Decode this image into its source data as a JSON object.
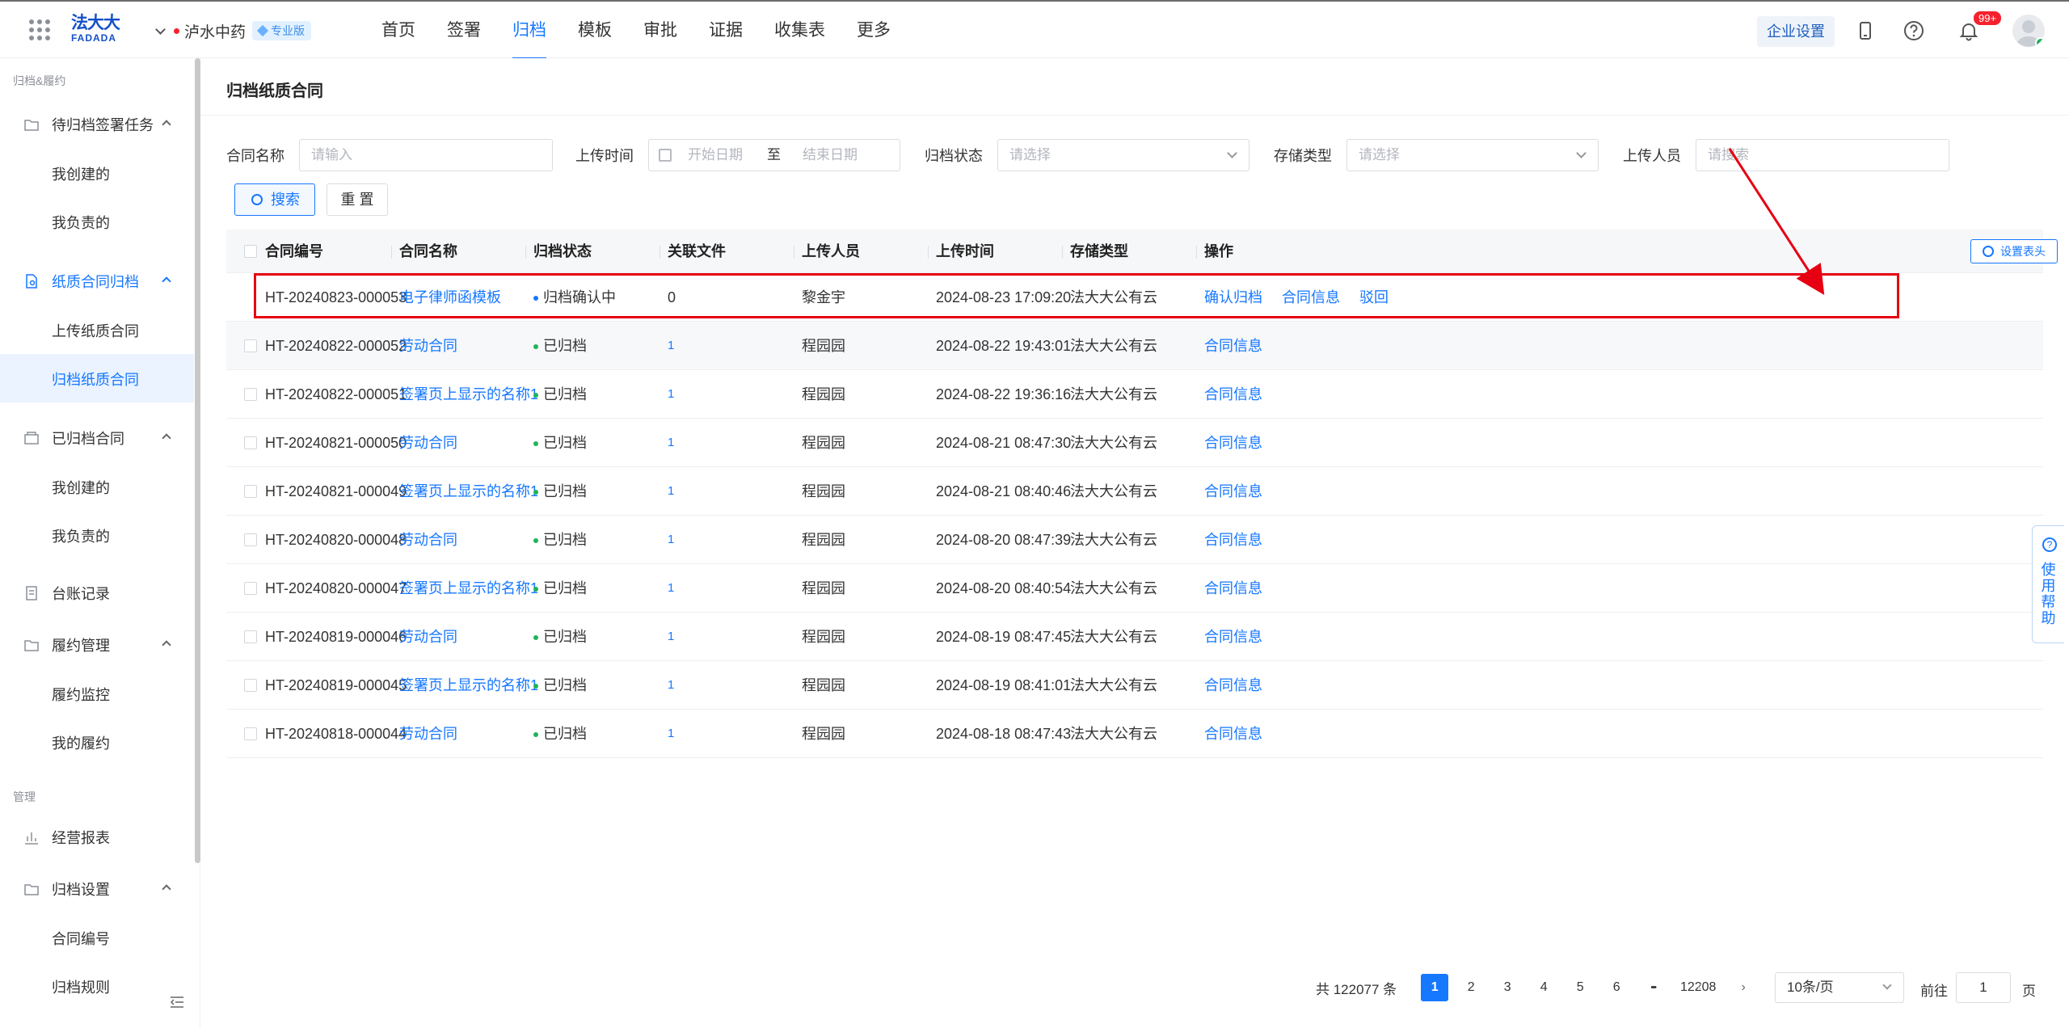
{
  "app": {
    "logo_cn": "法大大",
    "logo_en": "FADADA",
    "org_name": "泸水中药",
    "edition": "专业版",
    "nav": [
      "首页",
      "签署",
      "归档",
      "模板",
      "审批",
      "证据",
      "收集表",
      "更多"
    ],
    "nav_active": 2,
    "corp_settings": "企业设置",
    "notif_count": "99+"
  },
  "sidebar": {
    "group1": "归档&履约",
    "group2": "管理",
    "items": [
      {
        "label": "待归档签署任务",
        "icon": "folder-icon",
        "sub": [
          "我创建的",
          "我负责的"
        ]
      },
      {
        "label": "纸质合同归档",
        "icon": "file-search-icon",
        "sub": [
          "上传纸质合同",
          "归档纸质合同"
        ],
        "active_sub": 1
      },
      {
        "label": "已归档合同",
        "icon": "archive-box-icon",
        "sub": [
          "我创建的",
          "我负责的"
        ]
      },
      {
        "label": "台账记录",
        "icon": "ledger-icon",
        "sub": []
      },
      {
        "label": "履约管理",
        "icon": "folder-check-icon",
        "sub": [
          "履约监控",
          "我的履约"
        ]
      },
      {
        "label": "经营报表",
        "icon": "bar-chart-icon",
        "sub": []
      },
      {
        "label": "归档设置",
        "icon": "folder-settings-icon",
        "sub": [
          "合同编号",
          "归档规则"
        ]
      }
    ]
  },
  "page": {
    "title": "归档纸质合同",
    "filters": {
      "contract_name_label": "合同名称",
      "contract_name_placeholder": "请输入",
      "upload_time_label": "上传时间",
      "start_date": "开始日期",
      "to": "至",
      "end_date": "结束日期",
      "status_label": "归档状态",
      "status_placeholder": "请选择",
      "storage_label": "存储类型",
      "storage_placeholder": "请选择",
      "uploader_label": "上传人员",
      "uploader_placeholder": "请搜索"
    },
    "search_btn": "搜索",
    "reset_btn": "重 置",
    "set_columns": "设置表头"
  },
  "table": {
    "columns": [
      "合同编号",
      "合同名称",
      "归档状态",
      "关联文件",
      "上传人员",
      "上传时间",
      "存储类型",
      "操作"
    ],
    "rows": [
      {
        "id": "HT-20240823-000053",
        "name": "电子律师函模板",
        "status": "归档确认中",
        "status_color": "#1677ff",
        "files": "0",
        "uploader": "黎金宇",
        "time": "2024-08-23 17:09:20",
        "storage": "法大大公有云",
        "actions": [
          "确认归档",
          "合同信息",
          "驳回"
        ]
      },
      {
        "id": "HT-20240822-000052",
        "name": "劳动合同",
        "status": "已归档",
        "status_color": "#20b25a",
        "files": "1",
        "uploader": "程园园",
        "time": "2024-08-22 19:43:01",
        "storage": "法大大公有云",
        "actions": [
          "合同信息"
        ]
      },
      {
        "id": "HT-20240822-000051",
        "name": "签署页上显示的名称1",
        "status": "已归档",
        "status_color": "#20b25a",
        "files": "1",
        "uploader": "程园园",
        "time": "2024-08-22 19:36:16",
        "storage": "法大大公有云",
        "actions": [
          "合同信息"
        ]
      },
      {
        "id": "HT-20240821-000050",
        "name": "劳动合同",
        "status": "已归档",
        "status_color": "#20b25a",
        "files": "1",
        "uploader": "程园园",
        "time": "2024-08-21 08:47:30",
        "storage": "法大大公有云",
        "actions": [
          "合同信息"
        ]
      },
      {
        "id": "HT-20240821-000049",
        "name": "签署页上显示的名称1",
        "status": "已归档",
        "status_color": "#20b25a",
        "files": "1",
        "uploader": "程园园",
        "time": "2024-08-21 08:40:46",
        "storage": "法大大公有云",
        "actions": [
          "合同信息"
        ]
      },
      {
        "id": "HT-20240820-000048",
        "name": "劳动合同",
        "status": "已归档",
        "status_color": "#20b25a",
        "files": "1",
        "uploader": "程园园",
        "time": "2024-08-20 08:47:39",
        "storage": "法大大公有云",
        "actions": [
          "合同信息"
        ]
      },
      {
        "id": "HT-20240820-000047",
        "name": "签署页上显示的名称1",
        "status": "已归档",
        "status_color": "#20b25a",
        "files": "1",
        "uploader": "程园园",
        "time": "2024-08-20 08:40:54",
        "storage": "法大大公有云",
        "actions": [
          "合同信息"
        ]
      },
      {
        "id": "HT-20240819-000046",
        "name": "劳动合同",
        "status": "已归档",
        "status_color": "#20b25a",
        "files": "1",
        "uploader": "程园园",
        "time": "2024-08-19 08:47:45",
        "storage": "法大大公有云",
        "actions": [
          "合同信息"
        ]
      },
      {
        "id": "HT-20240819-000045",
        "name": "签署页上显示的名称1",
        "status": "已归档",
        "status_color": "#20b25a",
        "files": "1",
        "uploader": "程园园",
        "time": "2024-08-19 08:41:01",
        "storage": "法大大公有云",
        "actions": [
          "合同信息"
        ]
      },
      {
        "id": "HT-20240818-000044",
        "name": "劳动合同",
        "status": "已归档",
        "status_color": "#20b25a",
        "files": "1",
        "uploader": "程园园",
        "time": "2024-08-18 08:47:43",
        "storage": "法大大公有云",
        "actions": [
          "合同信息"
        ]
      }
    ]
  },
  "pagination": {
    "total": "共 122077 条",
    "pages": [
      "1",
      "2",
      "3",
      "4",
      "5",
      "6"
    ],
    "ellipsis": "•••",
    "last": "12208",
    "current": "1",
    "page_size": "10条/页",
    "goto_label": "前往",
    "goto_value": "1",
    "page_suffix": "页"
  },
  "help_tab": "使用帮助",
  "colors": {
    "primary": "#1677ff",
    "annotation": "#e60012",
    "success": "#20b25a"
  }
}
